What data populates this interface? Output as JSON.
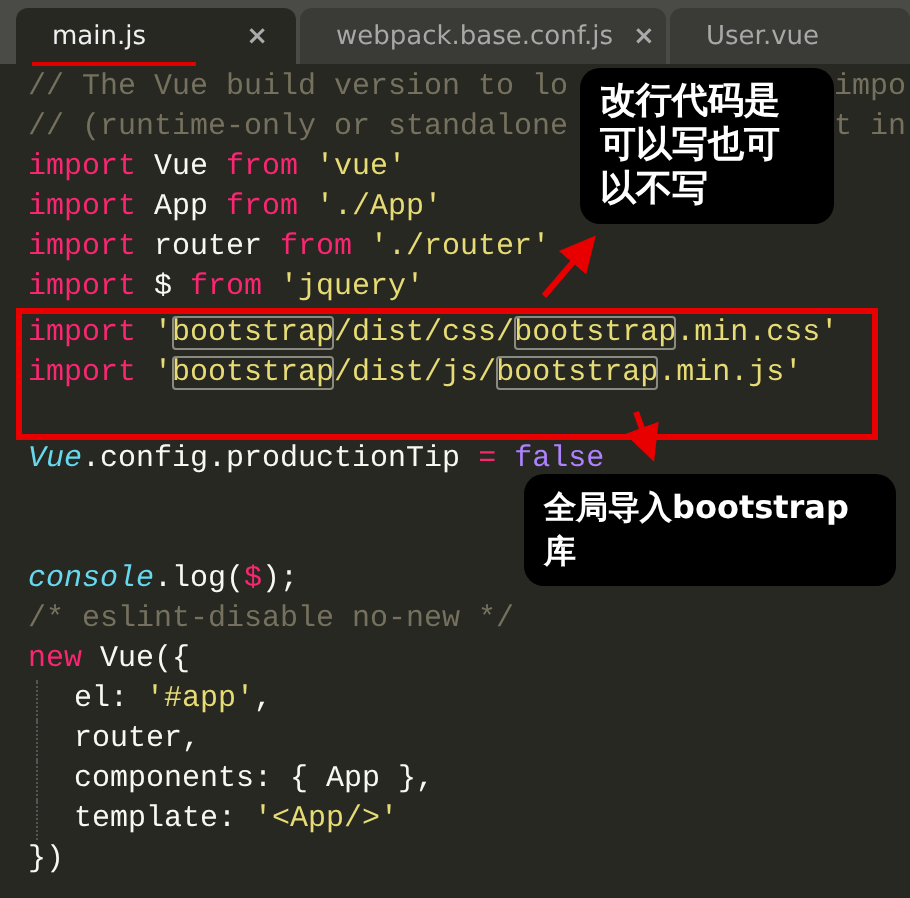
{
  "tabs": [
    {
      "label": "main.js",
      "selected": true,
      "close_glyph": "×"
    },
    {
      "label": "webpack.base.conf.js",
      "selected": false,
      "close_glyph": "×"
    },
    {
      "label": "User.vue",
      "selected": false
    }
  ],
  "editor": {
    "lines": [
      {
        "kind": "code",
        "tokens": [
          {
            "text": "// The Vue build version to lo",
            "kind": "comment"
          }
        ],
        "trailing": {
          "text": "impo",
          "kind": "comment"
        }
      },
      {
        "kind": "code",
        "tokens": [
          {
            "text": "// (runtime-only or standalone",
            "kind": "comment"
          }
        ],
        "trailing": {
          "text": "t in",
          "kind": "comment"
        }
      },
      {
        "kind": "code",
        "tokens": [
          {
            "text": "import",
            "kind": "keyword"
          },
          {
            "text": " Vue ",
            "kind": "plain"
          },
          {
            "text": "from",
            "kind": "keyword"
          },
          {
            "text": " 'vue'",
            "kind": "string"
          }
        ]
      },
      {
        "kind": "code",
        "tokens": [
          {
            "text": "import",
            "kind": "keyword"
          },
          {
            "text": " App ",
            "kind": "plain"
          },
          {
            "text": "from",
            "kind": "keyword"
          },
          {
            "text": " './App'",
            "kind": "string"
          }
        ]
      },
      {
        "kind": "code",
        "tokens": [
          {
            "text": "import",
            "kind": "keyword"
          },
          {
            "text": " router ",
            "kind": "plain"
          },
          {
            "text": "from",
            "kind": "keyword"
          },
          {
            "text": " './router'",
            "kind": "string"
          }
        ]
      },
      {
        "kind": "code",
        "tokens": [
          {
            "text": "import",
            "kind": "keyword"
          },
          {
            "text": " $ ",
            "kind": "plain"
          },
          {
            "text": "from",
            "kind": "keyword"
          },
          {
            "text": " 'jquery'",
            "kind": "string"
          }
        ]
      },
      {
        "kind": "code",
        "framed": true,
        "tokens": [
          {
            "text": "import",
            "kind": "keyword"
          },
          {
            "text": " '",
            "kind": "string"
          },
          {
            "text": "bootstrap",
            "kind": "string",
            "match": true
          },
          {
            "text": "/dist/css/",
            "kind": "string"
          },
          {
            "text": "bootstrap",
            "kind": "string",
            "match": true
          },
          {
            "text": ".min.css'",
            "kind": "string"
          }
        ]
      },
      {
        "kind": "code",
        "framed": true,
        "tokens": [
          {
            "text": "import",
            "kind": "keyword"
          },
          {
            "text": " '",
            "kind": "string"
          },
          {
            "text": "bootstrap",
            "kind": "string",
            "match": true
          },
          {
            "text": "/dist/js/",
            "kind": "string"
          },
          {
            "text": "bootstrap",
            "kind": "string",
            "match": true
          },
          {
            "text": ".min.js'",
            "kind": "string"
          }
        ]
      },
      {
        "kind": "blank",
        "framed": true
      },
      {
        "kind": "code",
        "tokens": [
          {
            "text": "Vue",
            "kind": "builtin"
          },
          {
            "text": ".config.productionTip ",
            "kind": "plain"
          },
          {
            "text": "=",
            "kind": "keyword"
          },
          {
            "text": " false",
            "kind": "constant"
          }
        ]
      },
      {
        "kind": "blank"
      },
      {
        "kind": "blank"
      },
      {
        "kind": "code",
        "tokens": [
          {
            "text": "console",
            "kind": "builtin"
          },
          {
            "text": ".log(",
            "kind": "plain"
          },
          {
            "text": "$",
            "kind": "keyword"
          },
          {
            "text": ");",
            "kind": "plain"
          }
        ]
      },
      {
        "kind": "code",
        "tokens": [
          {
            "text": "/* eslint-disable no-new */",
            "kind": "comment"
          }
        ]
      },
      {
        "kind": "code",
        "tokens": [
          {
            "text": "new",
            "kind": "keyword"
          },
          {
            "text": " Vue({",
            "kind": "plain"
          }
        ]
      },
      {
        "kind": "code",
        "indented": true,
        "tokens": [
          {
            "text": "el: ",
            "kind": "plain"
          },
          {
            "text": "'#app'",
            "kind": "string"
          },
          {
            "text": ",",
            "kind": "plain"
          }
        ]
      },
      {
        "kind": "code",
        "indented": true,
        "tokens": [
          {
            "text": "router,",
            "kind": "plain"
          }
        ]
      },
      {
        "kind": "code",
        "indented": true,
        "tokens": [
          {
            "text": "components: { App },",
            "kind": "plain"
          }
        ]
      },
      {
        "kind": "code",
        "indented": true,
        "tokens": [
          {
            "text": "template: ",
            "kind": "plain"
          },
          {
            "text": "'<App/>'",
            "kind": "string"
          }
        ]
      },
      {
        "kind": "code",
        "tokens": [
          {
            "text": "})",
            "kind": "plain"
          }
        ]
      }
    ]
  },
  "callouts": [
    {
      "text": "改行代码是可以写也可以不写"
    },
    {
      "text": "全局导入bootstrap库"
    }
  ]
}
